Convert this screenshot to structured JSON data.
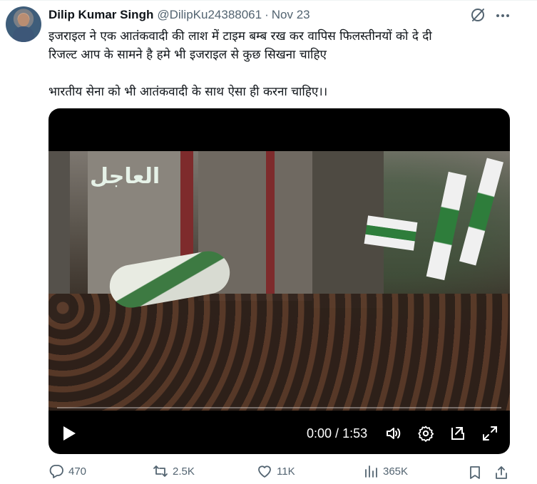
{
  "tweet": {
    "author_name": "Dilip Kumar Singh",
    "handle": "@DilipKu24388061",
    "separator": "·",
    "date": "Nov 23",
    "text_line1": "इजराइल ने एक आतंकवादी की लाश में टाइम बम्ब रख कर वापिस फिलस्तीनयों को दे दी",
    "text_line2": "रिजल्ट आप के सामने है हमे भी इजराइल से कुछ सिखना चाहिए",
    "text_line3": "भारतीय सेना को भी आतंकवादी के साथ ऐसा ही करना चाहिए।।"
  },
  "video": {
    "overlay_text": "ﺍﻟﻌﺎﺟﻞ",
    "time_current": "0:00",
    "time_sep": " / ",
    "time_total": "1:53",
    "progress": 0
  },
  "actions": {
    "replies": "470",
    "reposts": "2.5K",
    "likes": "11K",
    "views": "365K"
  }
}
